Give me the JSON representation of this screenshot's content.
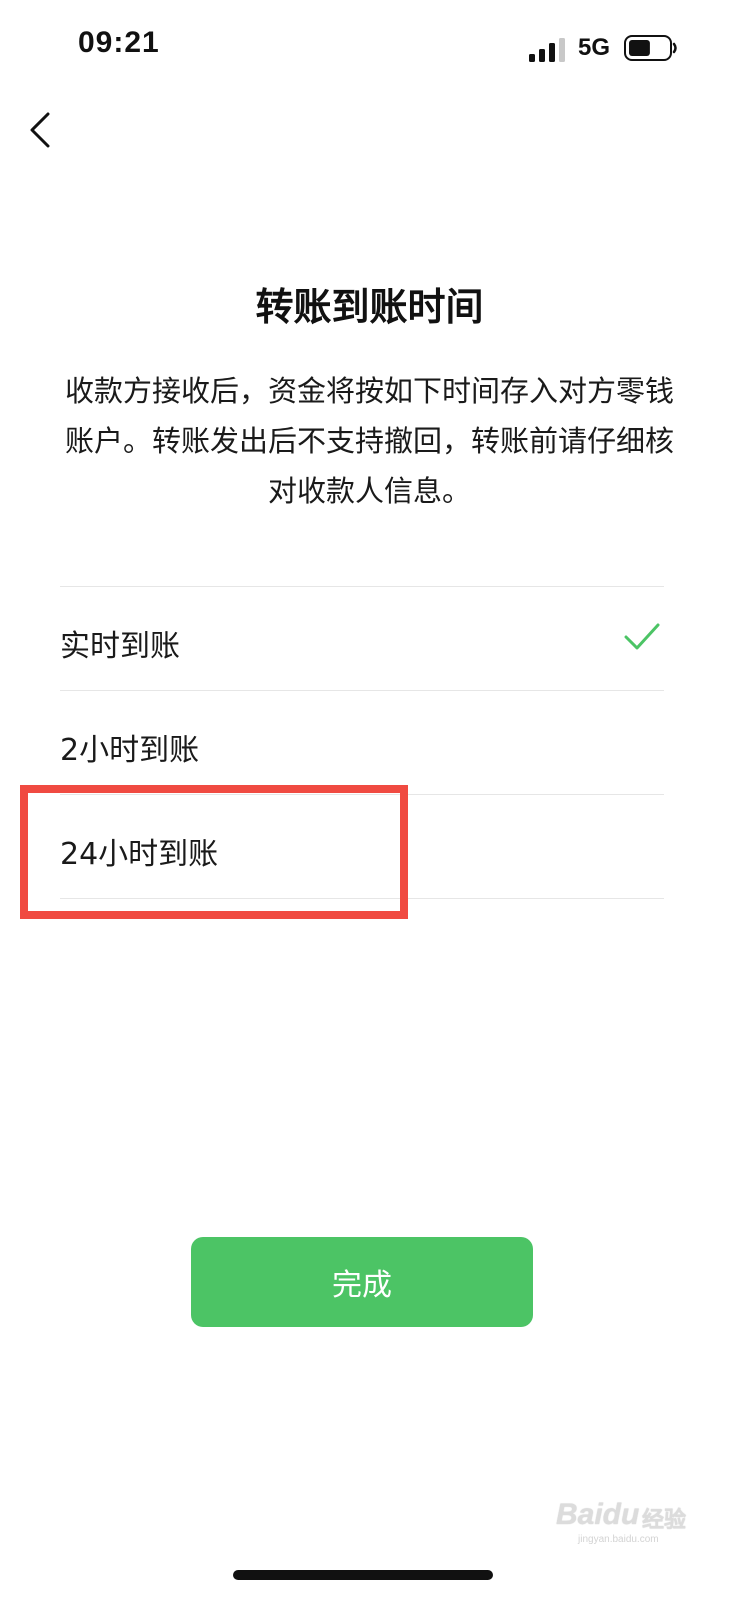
{
  "status_bar": {
    "time": "09:21",
    "network": "5G",
    "battery_level": 0.55
  },
  "header": {
    "back_icon": "chevron-left-icon"
  },
  "title": "转账到账时间",
  "description": "收款方接收后，资金将按如下时间存入对方零钱账户。转账发出后不支持撤回，转账前请仔细核对收款人信息。",
  "options": [
    {
      "label": "实时到账",
      "selected": true
    },
    {
      "label": "2小时到账",
      "selected": false
    },
    {
      "label": "24小时到账",
      "selected": false
    }
  ],
  "done_button": {
    "label": "完成"
  },
  "watermark": {
    "logo": "Baidu",
    "text": "经验",
    "url": "jingyan.baidu.com"
  },
  "colors": {
    "accent_green": "#4cc465",
    "check_green": "#4cc465",
    "highlight_red": "#f04a41"
  }
}
